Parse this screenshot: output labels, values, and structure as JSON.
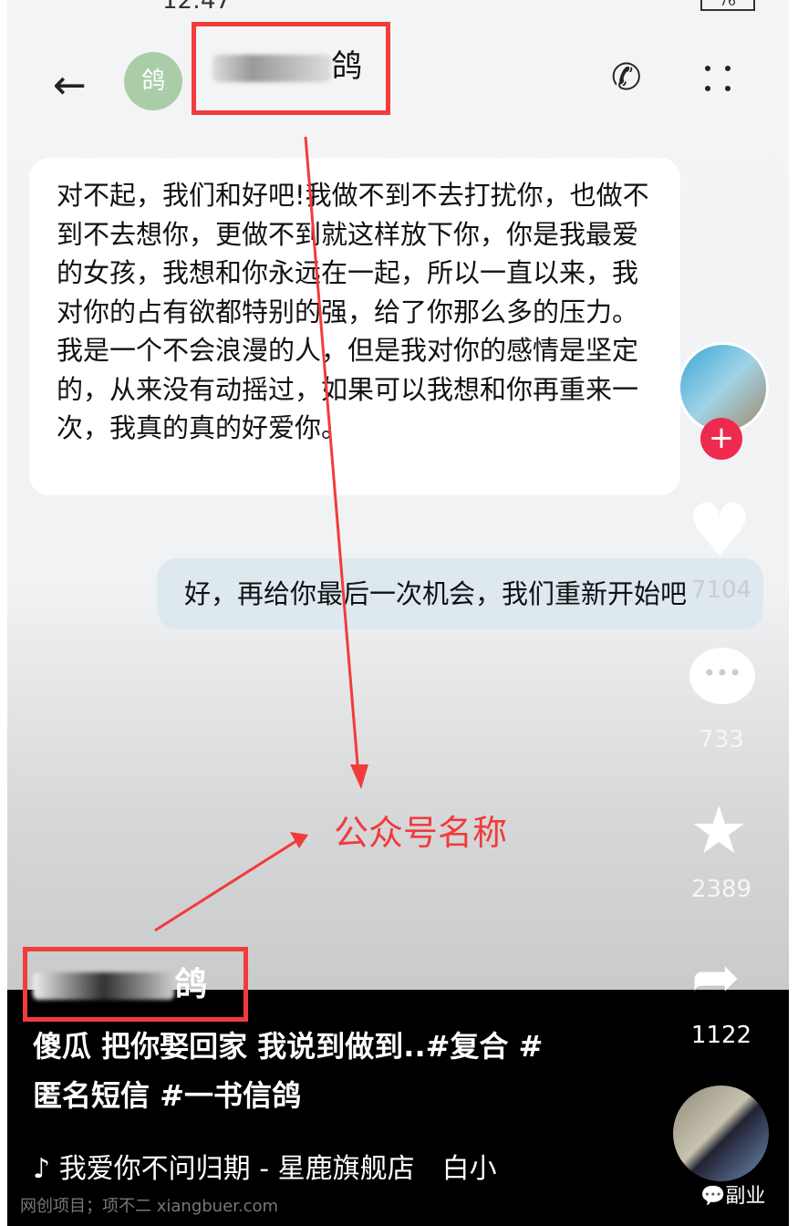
{
  "status_bar": {
    "time": "12:47",
    "battery": "76"
  },
  "header": {
    "avatar_text": "鸽",
    "title_suffix": "鸽"
  },
  "messages": [
    {
      "side": "received",
      "text": "对不起，我们和好吧!我做不到不去打扰你，也做不到不去想你，更做不到就这样放下你，你是我最爱的女孩，我想和你永远在一起，所以一直以来，我对你的占有欲都特别的强，给了你那么多的压力。我是一个不会浪漫的人，但是我对你的感情是坚定的，从来没有动摇过，如果可以我想和你再重来一次，我真的真的好爱你。"
    },
    {
      "side": "sent",
      "text": "好，再给你最后一次机会，我们重新开始吧"
    }
  ],
  "annotation": {
    "label": "公众号名称",
    "color": "#f23b3b"
  },
  "actions": {
    "likes": "7104",
    "comments": "733",
    "favorites": "2389",
    "shares": "1122"
  },
  "video": {
    "author_suffix": "鸽",
    "caption_line1": "傻瓜 把你娶回家 我说到做到..#复合 #",
    "caption_line2": "匿名短信 #一书信鸽",
    "music": "我爱你不问归期 - 星鹿旗舰店　白小"
  },
  "watermark": {
    "left": "网创项目；项不二 xiangbuer.com",
    "right": "副业"
  }
}
